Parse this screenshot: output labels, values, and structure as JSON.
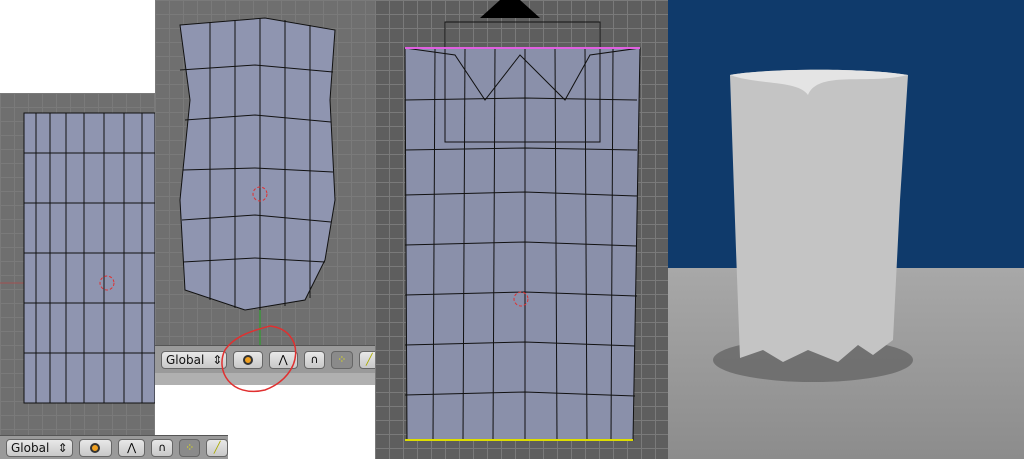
{
  "left_panel": {
    "toolbar": {
      "transform_orientation": "Global",
      "pivot_icon": "pivot-point-icon",
      "proportional_icon": "proportional-falloff-icon",
      "snap_icon": "magnet-icon",
      "vertex_select_icon": "vertex-select-icon",
      "edge_select_icon": "edge-select-icon"
    }
  },
  "middle_panel": {
    "toolbar": {
      "transform_orientation": "Global",
      "pivot_icon": "pivot-point-icon",
      "proportional_icon": "proportional-falloff-icon",
      "snap_icon": "magnet-icon",
      "vertex_select_icon": "vertex-select-icon",
      "edge_select_icon": "edge-select-icon"
    }
  },
  "colors": {
    "viewport_bg": "#6f6f6f",
    "mesh": "#8f95b0",
    "vertex": "#e060e0",
    "render_sky": "#0f3a6b",
    "render_floor": "#9c9c9c",
    "annotation": "#e03030"
  }
}
